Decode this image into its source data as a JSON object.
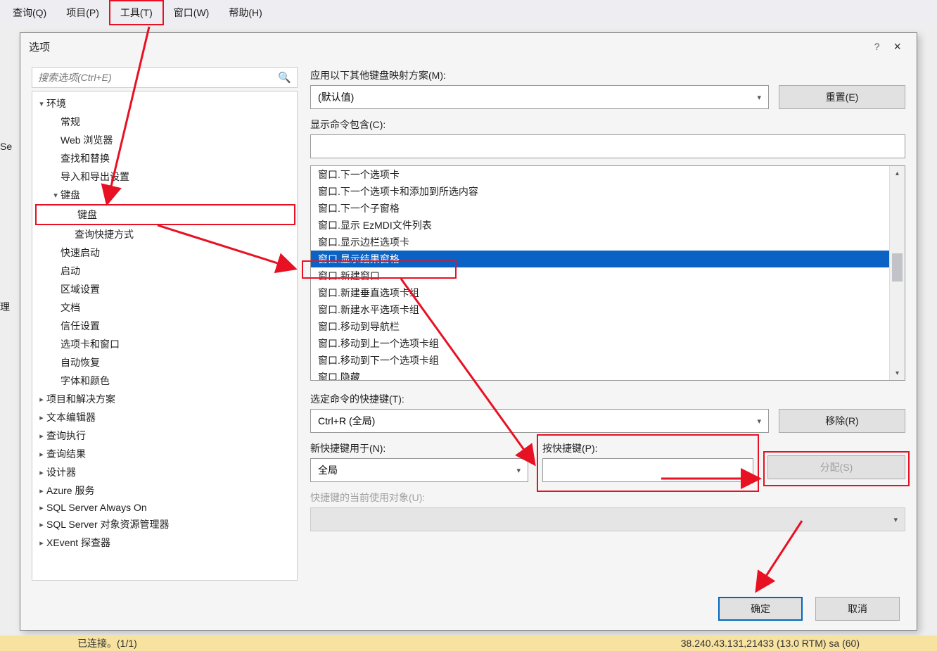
{
  "menubar": {
    "items": [
      "查询(Q)",
      "项目(P)",
      "工具(T)",
      "窗口(W)",
      "帮助(H)"
    ]
  },
  "leftstrip": {
    "a": "Se",
    "b": "理"
  },
  "dialog": {
    "title": "选项",
    "help": "?",
    "close": "×"
  },
  "search": {
    "placeholder": "搜索选项(Ctrl+E)"
  },
  "tree": {
    "env": "环境",
    "general": "常规",
    "web": "Web 浏览器",
    "find": "查找和替换",
    "import": "导入和导出设置",
    "kb_parent": "键盘",
    "kb": "键盘",
    "qshort": "查询快捷方式",
    "quick": "快速启动",
    "startup": "启动",
    "region": "区域设置",
    "doc": "文档",
    "trust": "信任设置",
    "tabs": "选项卡和窗口",
    "auto": "自动恢复",
    "font": "字体和颜色",
    "proj": "项目和解决方案",
    "editor": "文本编辑器",
    "qexec": "查询执行",
    "qres": "查询结果",
    "designer": "设计器",
    "azure": "Azure 服务",
    "always": "SQL Server Always On",
    "objmgr": "SQL Server 对象资源管理器",
    "xevent": "XEvent 探查器"
  },
  "labels": {
    "mapping": "应用以下其他键盘映射方案(M):",
    "contains": "显示命令包含(C):",
    "current_shortcut": "选定命令的快捷键(T):",
    "new_scope": "新快捷键用于(N):",
    "press": "按快捷键(P):",
    "current_use": "快捷键的当前使用对象(U):"
  },
  "mapping_combo": "(默认值)",
  "reset_btn": "重置(E)",
  "commands": [
    "窗口.下一个选项卡",
    "窗口.下一个选项卡和添加到所选内容",
    "窗口.下一个子窗格",
    "窗口.显示 EzMDI文件列表",
    "窗口.显示边栏选项卡",
    "窗口.显示结果窗格",
    "窗口.新建窗口",
    "窗口.新建垂直选项卡组",
    "窗口.新建水平选项卡组",
    "窗口.移动到导航栏",
    "窗口.移动到上一个选项卡组",
    "窗口.移动到下一个选项卡组",
    "窗口.隐藏"
  ],
  "selected_cmd_index": 5,
  "current_shortcut_combo": "Ctrl+R (全局)",
  "remove_btn": "移除(R)",
  "scope_combo": "全局",
  "assign_btn": "分配(S)",
  "ok_btn": "确定",
  "cancel_btn": "取消",
  "status": {
    "left": "已连接。(1/1)",
    "right": "38.240.43.131,21433 (13.0 RTM)   sa (60)"
  }
}
